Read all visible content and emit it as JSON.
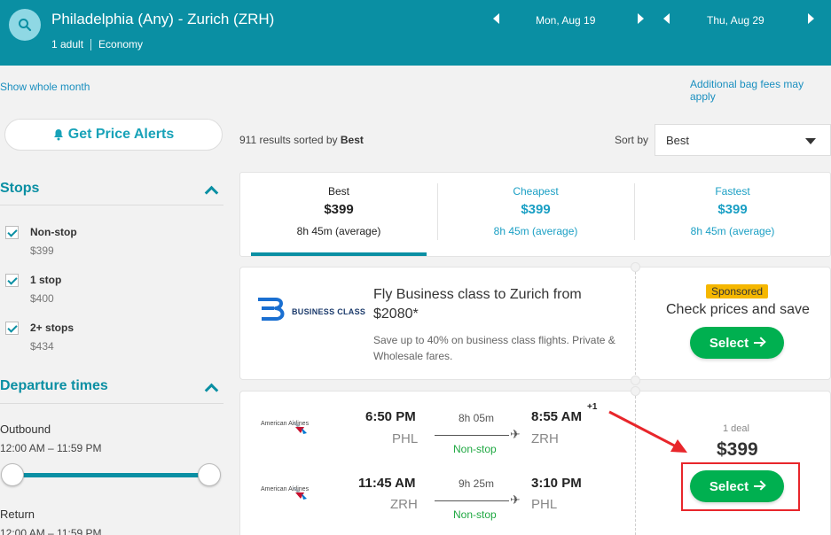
{
  "header": {
    "route": "Philadelphia (Any) - Zurich (ZRH)",
    "passengers": "1 adult",
    "cabin": "Economy",
    "depart_date": "Mon, Aug 19",
    "return_date": "Thu, Aug 29"
  },
  "links": {
    "show_whole_month": "Show whole month",
    "bag_fees": "Additional bag fees may apply"
  },
  "sidebar": {
    "price_alerts_label": "Get Price Alerts",
    "stops_title": "Stops",
    "stops": [
      {
        "label": "Non-stop",
        "price": "$399",
        "checked": true
      },
      {
        "label": "1 stop",
        "price": "$400",
        "checked": true
      },
      {
        "label": "2+ stops",
        "price": "$434",
        "checked": true
      }
    ],
    "departure_title": "Departure times",
    "outbound_label": "Outbound",
    "outbound_range": "12:00 AM – 11:59 PM",
    "return_label": "Return",
    "return_range": "12:00 AM – 11:59 PM"
  },
  "results": {
    "count": "911 results sorted by",
    "sorted_by": "Best",
    "sort_label": "Sort by",
    "sort_value": "Best"
  },
  "tabs": [
    {
      "label": "Best",
      "price": "$399",
      "duration": "8h 45m (average)",
      "active": true
    },
    {
      "label": "Cheapest",
      "price": "$399",
      "duration": "8h 45m (average)",
      "active": false
    },
    {
      "label": "Fastest",
      "price": "$399",
      "duration": "8h 45m (average)",
      "active": false
    }
  ],
  "sponsored": {
    "brand": "BUSINESS CLASS",
    "headline": "Fly Business class to Zurich from $2080*",
    "description": "Save up to 40% on business class flights. Private & Wholesale fares.",
    "badge": "Sponsored",
    "cta_text": "Check prices and save",
    "button": "Select"
  },
  "flight": {
    "airline": "American Airlines",
    "outbound": {
      "depart_time": "6:50 PM",
      "depart_airport": "PHL",
      "duration": "8h 05m",
      "stops": "Non-stop",
      "arrive_time": "8:55 AM",
      "day_offset": "+1",
      "arrive_airport": "ZRH"
    },
    "inbound": {
      "depart_time": "11:45 AM",
      "depart_airport": "ZRH",
      "duration": "9h 25m",
      "stops": "Non-stop",
      "arrive_time": "3:10 PM",
      "arrive_airport": "PHL"
    },
    "deals": "1 deal",
    "price": "$399",
    "button": "Select"
  },
  "colors": {
    "header": "#0a8fa3",
    "accent": "#0a8fa3",
    "select_button": "#00b050",
    "highlight": "#e8262b"
  }
}
